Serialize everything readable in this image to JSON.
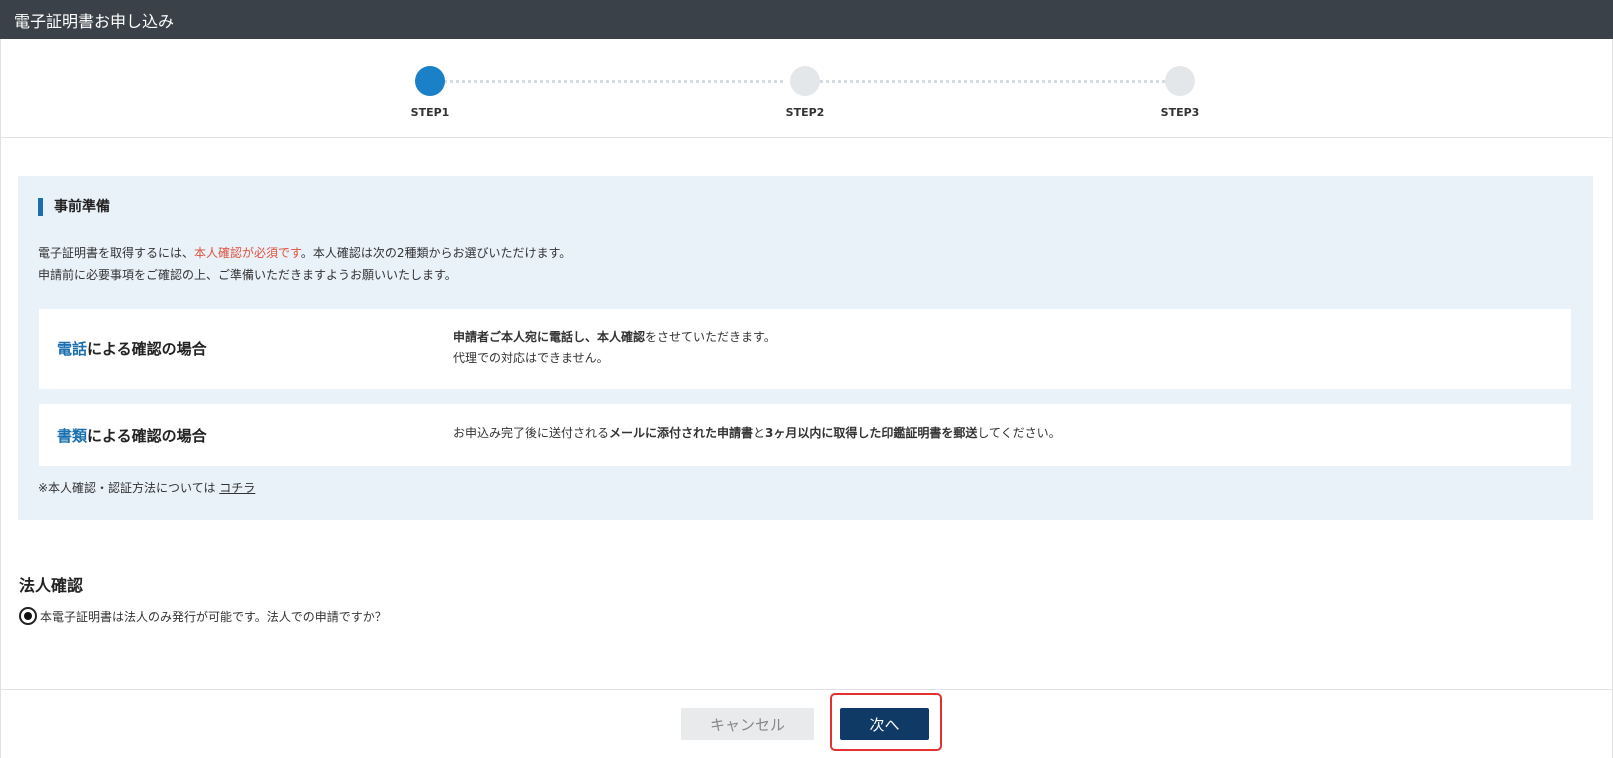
{
  "header": {
    "title": "電子証明書お申し込み"
  },
  "stepper": {
    "steps": [
      {
        "label": "STEP1",
        "active": true
      },
      {
        "label": "STEP2",
        "active": false
      },
      {
        "label": "STEP3",
        "active": false
      }
    ]
  },
  "prep": {
    "title": "事前準備",
    "line1_before": "電子証明書を取得するには、",
    "line1_highlight": "本人確認が必須です",
    "line1_after": "。本人確認は次の2種類からお選びいただけます。",
    "line2": "申請前に必要事項をご確認の上、ご準備いただきますようお願いいたします。",
    "methods": [
      {
        "title_key": "電話",
        "title_rest": "による確認の場合",
        "desc_bold": "申請者ご本人宛に電話し、本人確認",
        "desc_rest": "をさせていただきます。",
        "desc_line2": "代理での対応はできません。"
      },
      {
        "title_key": "書類",
        "title_rest": "による確認の場合",
        "desc_a": "お申込み完了後に送付される",
        "desc_b": "メールに添付された申請書",
        "desc_c": "と",
        "desc_d": "3ヶ月以内に取得した印鑑証明書を郵送",
        "desc_e": "してください。"
      }
    ],
    "note_text": "※本人確認・認証方法については ",
    "note_link": "コチラ"
  },
  "corporate": {
    "title": "法人確認",
    "question": "本電子証明書は法人のみ発行が可能です。法人での申請ですか？",
    "checked": true
  },
  "footer": {
    "cancel_label": "キャンセル",
    "next_label": "次へ"
  },
  "colors": {
    "header_bg": "#3a4148",
    "accent_blue": "#1a80c8",
    "link_blue": "#1a6fb0",
    "required_red": "#e0533e",
    "next_button": "#0f3a66",
    "highlight_border": "#e53030"
  }
}
